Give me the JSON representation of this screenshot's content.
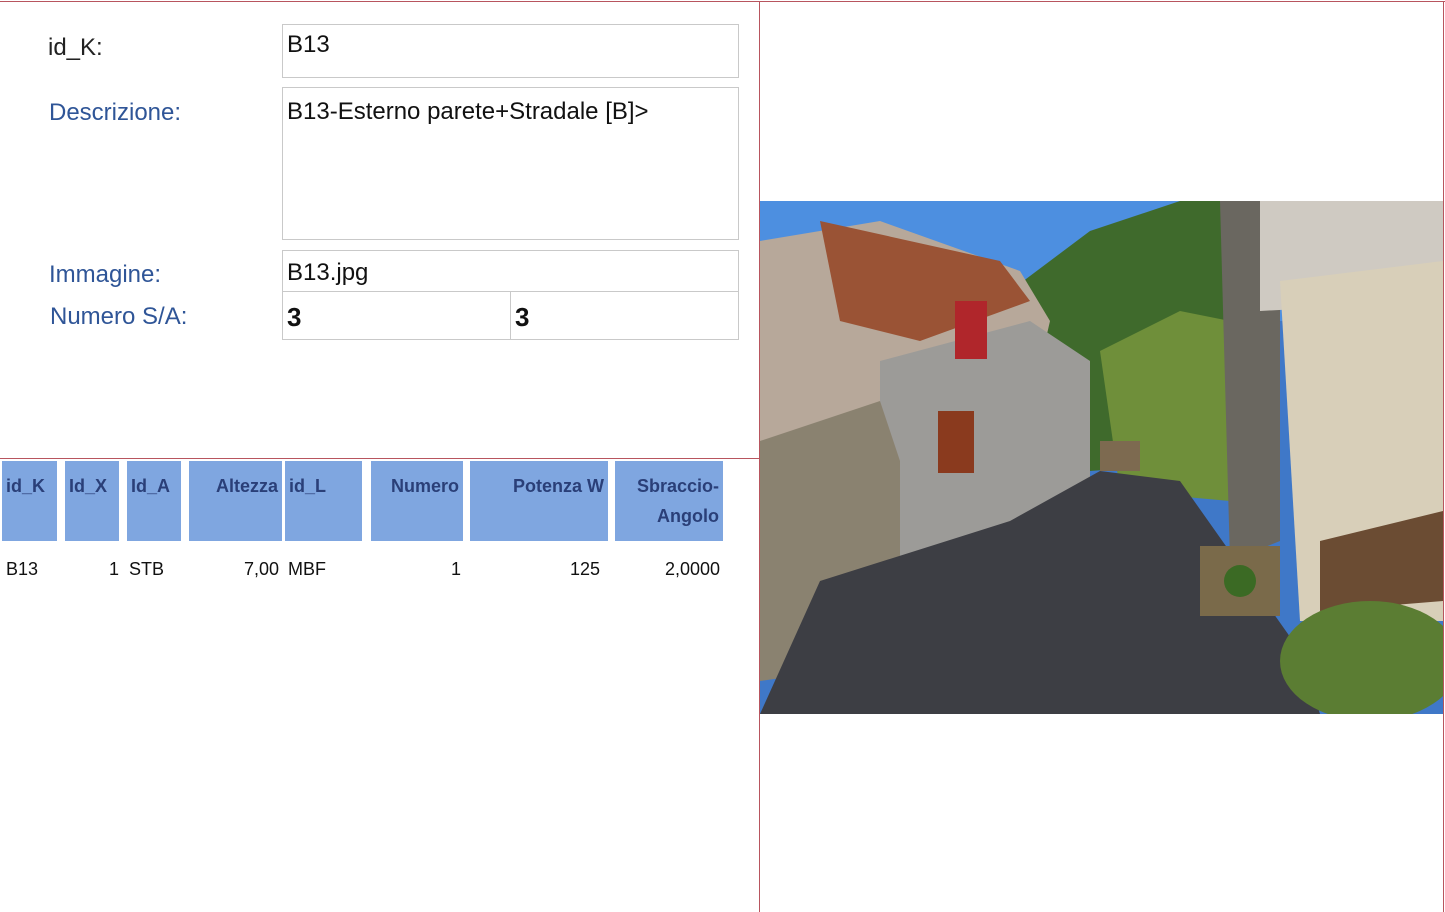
{
  "form": {
    "idk_label": "id_K:",
    "idk_value": "B13",
    "descrizione_label": "Descrizione:",
    "descrizione_value": "B13-Esterno parete+Stradale [B]>",
    "immagine_label": "Immagine:",
    "immagine_value": "B13.jpg",
    "numero_label": "Numero S/A:",
    "numero_s": "3",
    "numero_a": "3"
  },
  "table": {
    "headers": [
      "id_K",
      "Id_X",
      "Id_A",
      "Altezza",
      "id_L",
      "Numero",
      "Potenza W",
      "Sbraccio-Angolo"
    ],
    "rows": [
      [
        "B13",
        "1",
        "STB",
        "7,00",
        "MBF",
        "1",
        "125",
        "2,0000"
      ]
    ]
  },
  "colors": {
    "label_blue": "#2f5597",
    "header_bg": "#7fa6e0",
    "header_text": "#2a3f78",
    "frame_line": "#b8555e"
  }
}
